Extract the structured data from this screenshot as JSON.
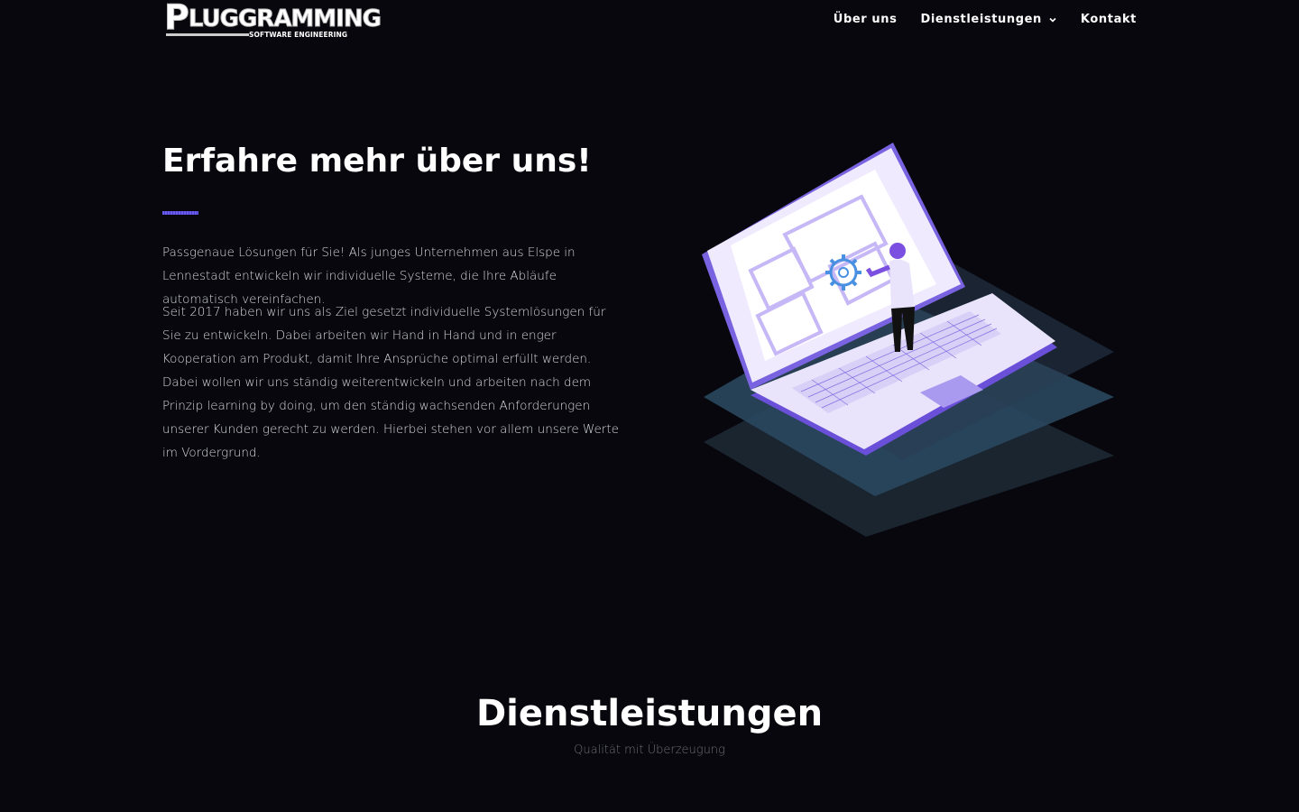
{
  "header": {
    "logo": {
      "main": "PLUGGRAMMING",
      "sub": "SOFTWARE ENGINEERING"
    },
    "nav": [
      {
        "label": "Über uns"
      },
      {
        "label": "Dienstleistungen",
        "icon": "chevron-down-icon"
      },
      {
        "label": "Kontakt"
      }
    ]
  },
  "hero": {
    "title": "Erfahre mehr über uns!",
    "paragraph1": "Passgenaue Lösungen für Sie! Als junges Unternehmen aus Elspe in Lennestadt entwickeln wir individuelle Systeme, die Ihre Abläufe automatisch vereinfachen.",
    "paragraph2": "Seit 2017 haben wir uns als Ziel gesetzt individuelle Systemlösungen für Sie zu entwickeln. Dabei arbeiten wir Hand in Hand und in enger Kooperation am Produkt, damit Ihre Ansprüche optimal erfüllt werden. Dabei wollen wir uns ständig weiterentwickeln und arbeiten nach dem Prinzip learning by doing, um den ständig wachsenden Anforderungen unserer Kunden gerecht zu werden. Hierbei stehen vor allem unsere Werte im Vordergrund.",
    "illustration": "isometric-laptop-illustration"
  },
  "services": {
    "title": "Dienstleistungen",
    "subtitle": "Qualität mit Überzeugung"
  },
  "colors": {
    "background": "#07070d",
    "accent": "#6b5cf0",
    "laptop": "#e9e4fb",
    "laptop_edge": "#6a4fd8",
    "layer": "#2b4a63"
  }
}
